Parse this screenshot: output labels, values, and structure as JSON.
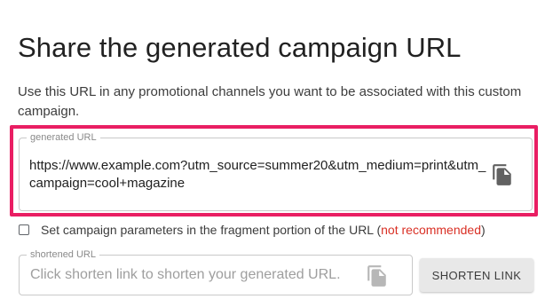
{
  "section": {
    "title": "Share the generated campaign URL",
    "description": "Use this URL in any promotional channels you want to be associated with this custom campaign."
  },
  "generated_url": {
    "legend": "generated URL",
    "value": "https://www.example.com?utm_source=summer20&utm_medium=print&utm_campaign=cool+magazine",
    "copy_icon": "copy-icon"
  },
  "fragment_option": {
    "checked": false,
    "label": "Set campaign parameters in the fragment portion of the URL",
    "open_paren": " (",
    "warning": "not recommended",
    "close_paren": ")"
  },
  "shortened_url": {
    "legend": "shortened URL",
    "placeholder": "Click shorten link to shorten your generated URL.",
    "copy_icon": "copy-icon"
  },
  "shorten_button": {
    "label": "SHORTEN LINK"
  },
  "colors": {
    "highlight": "#e91e63",
    "warning": "#d93025",
    "button_bg": "#e8e8e8"
  }
}
